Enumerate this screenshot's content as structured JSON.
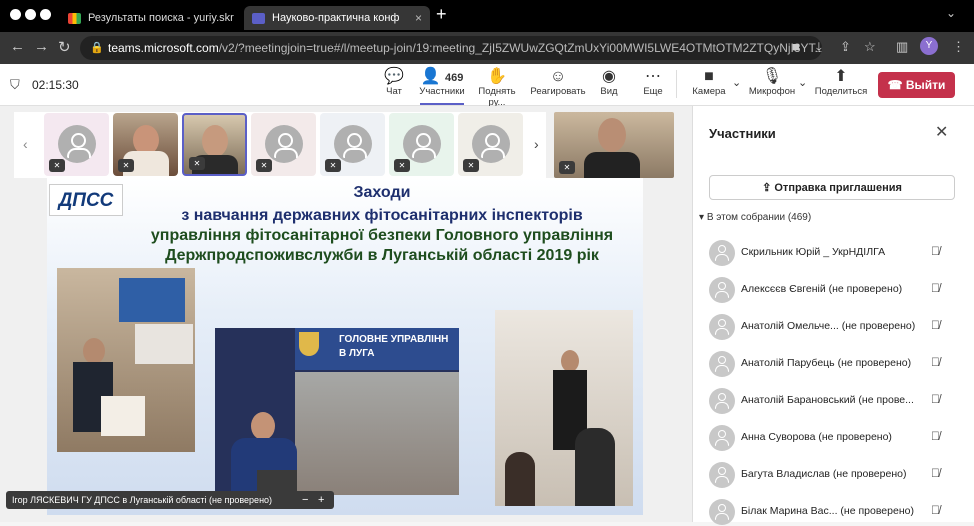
{
  "browser": {
    "tabs": [
      {
        "label": "Результаты поиска - yuriy.skr",
        "favicon": "gmail-icon"
      },
      {
        "label": "Науково-практична конф",
        "favicon": "teams-icon"
      }
    ],
    "url_host": "teams.microsoft.com",
    "url_path": "/v2/?meetingjoin=true#/l/meetup-join/19:meeting_ZjI5ZWUwZGQtZmUxYi00MWI5LWE4OTMtOTM2ZTQyNjI3YT...",
    "profile_initial": "Y"
  },
  "meeting": {
    "timer": "02:15:30",
    "participants_count": "469",
    "toolbar": {
      "chat": "Чат",
      "participants": "Участники",
      "raise_hand": "Поднять ру...",
      "react": "Реагировать",
      "view": "Вид",
      "more": "Еще",
      "camera": "Камера",
      "mic": "Микрофон",
      "share": "Поделиться",
      "leave": "Выйти"
    }
  },
  "slide": {
    "logo": "ДПСС",
    "title_lines": [
      "Заходи",
      "з навчання державних фітосанітарних інспекторів",
      "управління фітосанітарної безпеки Головного управління",
      "Держпродспоживслужби в Луганській області 2019 рік"
    ],
    "photo_banner": "ГОЛОВНЕ УПРАВЛІНН",
    "photo_banner2": "В ЛУГА"
  },
  "caption": "Ігор ЛЯСКЕВИЧ ГУ ДПСС в Луганській області (не проверено)",
  "panel": {
    "title": "Участники",
    "invite": "Отправка приглашения",
    "section": "В этом собрании (469)",
    "people": [
      "Скрильник Юрій _ УкрНДІЛГА",
      "Алексєєв Євгеній (не проверено)",
      "Анатолій Омельче... (не проверено)",
      "Анатолій Парубець (не проверено)",
      "Анатолій Барановський (не прове...",
      "Анна Суворова (не проверено)",
      "Багута Владислав (не проверено)",
      "Білак Марина Вас... (не проверено)"
    ]
  },
  "colors": {
    "leave": "#c4314b",
    "accent": "#5b5fc7"
  }
}
